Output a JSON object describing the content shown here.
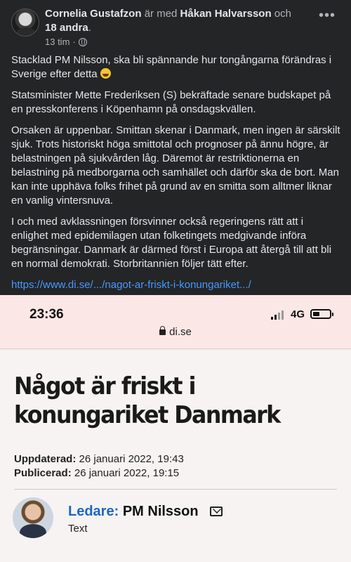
{
  "post": {
    "author": "Cornelia Gustafzon",
    "with_text": "är med",
    "tagged": "Håkan Halvarsson",
    "and_text": "och",
    "others": "18 andra",
    "time": "13 tim",
    "more_icon": "ellipsis-icon",
    "paragraphs": [
      "Stacklad PM Nilsson, ska bli spännande hur tongångarna förändras i Sverige efter detta",
      "Statsminister Mette Frederiksen (S) bekräftade senare budskapet på en presskonferens i Köpenhamn på onsdagskvällen.",
      "Orsaken är uppenbar. Smittan skenar i Danmark, men ingen är särskilt sjuk. Trots historiskt höga smittotal och prognoser på ännu högre, är belastningen på sjukvården låg. Däremot är restriktionerna en belastning på medborgarna och samhället och därför ska de bort. Man kan inte upphäva folks frihet på grund av en smitta som alltmer liknar en vanlig vintersnuva.",
      "I och med avklassningen försvinner också regeringens rätt att i enlighet med epidemilagen utan folketingets medgivande införa begränsningar. Danmark är därmed först i Europa att återgå till att bli en normal demokrati. Storbritannien följer tätt efter."
    ],
    "link": "https://www.di.se/.../nagot-ar-friskt-i-konungariket.../"
  },
  "screenshot": {
    "time": "23:36",
    "network": "4G",
    "domain": "di.se",
    "headline": "Något är friskt i konungariket Danmark",
    "updated_label": "Uppdaterad:",
    "updated_value": "26 januari 2022, 19:43",
    "published_label": "Publicerad:",
    "published_value": "26 januari 2022, 19:15",
    "category": "Ledare:",
    "author_name": "PM Nilsson",
    "author_sub": "Text"
  }
}
